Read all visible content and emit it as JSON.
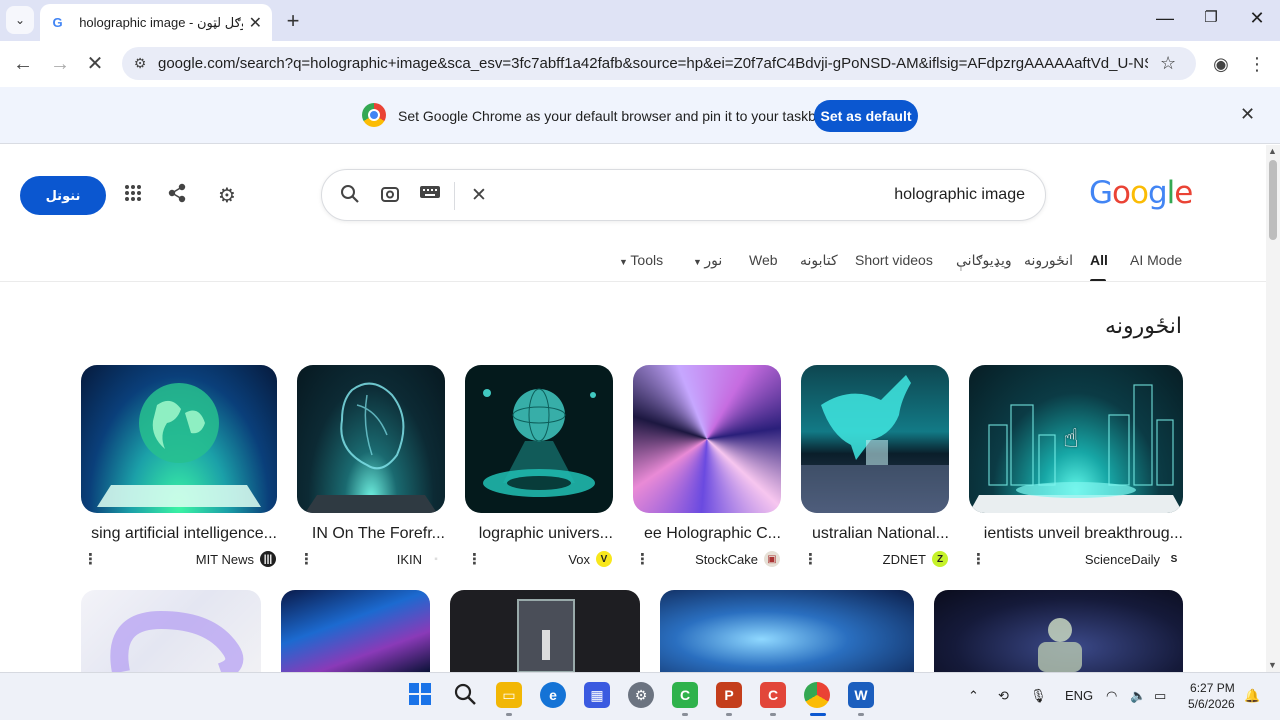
{
  "browser": {
    "tab_title": "holographic image - ګووګل لټون",
    "url": "google.com/search?q=holographic+image&sca_esv=3fc7abff1a42fafb&source=hp&ei=Z0f7afC4Bdvji-gPoNSD-AM&iflsig=AFdpzrgAAAAAaftVd_U-NSAKqFtrG...",
    "infobar_text": "Set Google Chrome as your default browser and pin it to your taskbar",
    "set_default_label": "Set as default"
  },
  "header": {
    "signin_label": "ننوتل",
    "search_query": "holographic image",
    "logo_text": "Google",
    "logo_colors": [
      "#4285f4",
      "#ea4335",
      "#fbbc05",
      "#4285f4",
      "#34a853",
      "#ea4335"
    ]
  },
  "nav_tabs": [
    {
      "label": "AI Mode"
    },
    {
      "label": "All"
    },
    {
      "label": "انځورونه"
    },
    {
      "label": "ویډیوګانې"
    },
    {
      "label": "Short videos"
    },
    {
      "label": "کتابونه"
    },
    {
      "label": "Web"
    },
    {
      "label": "نور"
    },
    {
      "label": "Tools"
    }
  ],
  "section_title": "انځورونه",
  "results": [
    {
      "title": "ientists unveil breakthroug...",
      "source": "ScienceDaily"
    },
    {
      "title": "ustralian National...",
      "source": "ZDNET"
    },
    {
      "title": "ee Holographic C...",
      "source": "StockCake"
    },
    {
      "title": "lographic univers...",
      "source": "Vox"
    },
    {
      "title": "IN On The Forefr...",
      "source": "IKIN"
    },
    {
      "title": "sing artificial intelligence...",
      "source": "MIT News"
    }
  ],
  "taskbar": {
    "language": "ENG",
    "time": "6:27 PM",
    "date": "5/6/2026"
  }
}
